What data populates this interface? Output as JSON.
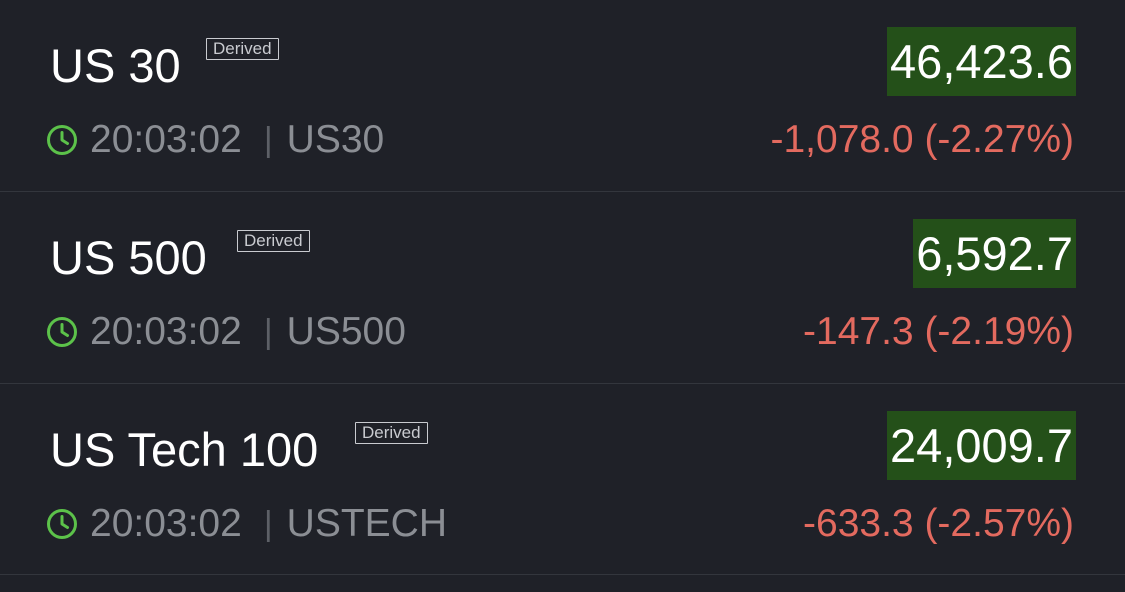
{
  "instruments": [
    {
      "name": "US 30",
      "badge": "Derived",
      "price": "46,423.6",
      "time": "20:03:02",
      "symbol": "US30",
      "change": "-1,078.0 (-2.27%)"
    },
    {
      "name": "US 500",
      "badge": "Derived",
      "price": "6,592.7",
      "time": "20:03:02",
      "symbol": "US500",
      "change": "-147.3 (-2.19%)"
    },
    {
      "name": "US Tech 100",
      "badge": "Derived",
      "price": "24,009.7",
      "time": "20:03:02",
      "symbol": "USTECH",
      "change": "-633.3 (-2.57%)"
    }
  ],
  "colors": {
    "background": "#1f2128",
    "price_up_bg": "#245019",
    "change_down": "#e36a5f",
    "clock_icon": "#5cc24a"
  },
  "icons": {
    "time": "clock-icon"
  }
}
